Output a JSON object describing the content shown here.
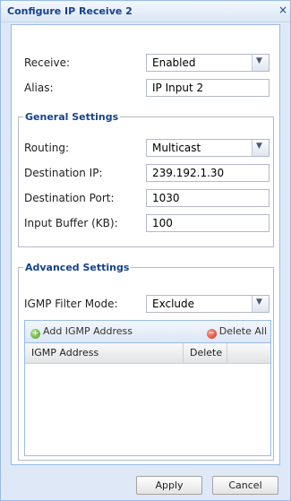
{
  "dialog": {
    "title": "Configure IP Receive 2",
    "close_glyph": "×"
  },
  "form": {
    "receive_label": "Receive:",
    "receive_value": "Enabled",
    "alias_label": "Alias:",
    "alias_value": "IP Input 2"
  },
  "general_settings": {
    "legend": "General Settings",
    "routing_label": "Routing:",
    "routing_value": "Multicast",
    "destination_ip_label": "Destination IP:",
    "destination_ip_value": "239.192.1.30",
    "destination_port_label": "Destination Port:",
    "destination_port_value": "1030",
    "input_buffer_label": "Input Buffer (KB):",
    "input_buffer_value": "100"
  },
  "advanced_settings": {
    "legend": "Advanced Settings",
    "igmp_filter_mode_label": "IGMP Filter Mode:",
    "igmp_filter_mode_value": "Exclude",
    "grid": {
      "add_button_label": "Add IGMP Address",
      "delete_all_label": "Delete All",
      "columns": [
        "IGMP Address",
        "Delete"
      ],
      "rows": []
    }
  },
  "footer": {
    "apply_label": "Apply",
    "cancel_label": "Cancel"
  },
  "icons": {
    "add": "add-circle-icon",
    "delete": "delete-circle-icon",
    "dropdown": "chevron-down-icon"
  }
}
